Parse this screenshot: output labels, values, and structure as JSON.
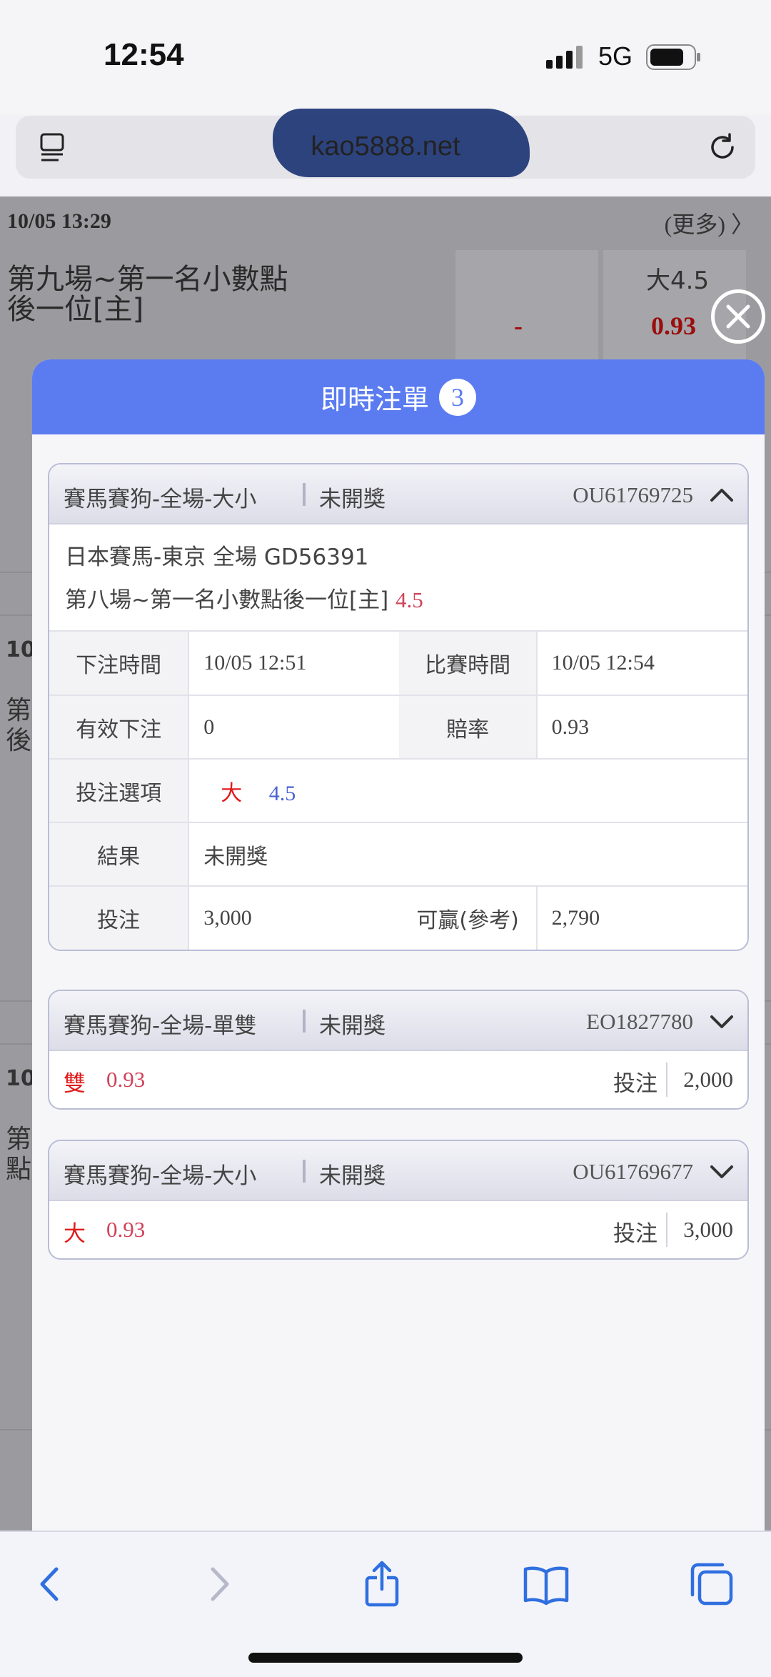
{
  "status_bar": {
    "time": "12:54",
    "network": "5G"
  },
  "browser": {
    "url": "kao5888.net"
  },
  "background": {
    "row1": {
      "datetime": "10/05  13:29",
      "more": "(更多) 〉",
      "match_line1": "第九場~第一名小數點",
      "match_line2": "後一位[主]",
      "dash": "-",
      "ou": "大4.5",
      "odds": "0.93"
    },
    "stubs": [
      "10/",
      "第",
      "後",
      "10/",
      "第",
      "點"
    ]
  },
  "modal": {
    "title": "即時注單",
    "count": "3",
    "cards": [
      {
        "type": "賽馬賽狗-全場-大小",
        "status": "未開獎",
        "code": "OU61769725",
        "league": "日本賽馬-東京 全場 GD56391",
        "match": "第八場~第一名小數點後一位[主]",
        "line": "4.5",
        "rows": {
          "bet_time_label": "下注時間",
          "bet_time": "10/05 12:51",
          "match_time_label": "比賽時間",
          "match_time": "10/05 12:54",
          "valid_label": "有效下注",
          "valid": "0",
          "odds_label": "賠率",
          "odds": "0.93",
          "option_label": "投注選項",
          "option_pick": "大",
          "option_line": "4.5",
          "result_label": "結果",
          "result": "未開獎",
          "stake_label": "投注",
          "stake": "3,000",
          "win_label": "可贏(參考)",
          "win": "2,790"
        }
      },
      {
        "type": "賽馬賽狗-全場-單雙",
        "status": "未開獎",
        "code": "EO1827780",
        "pick": "雙",
        "odds": "0.93",
        "stake_label": "投注",
        "stake": "2,000"
      },
      {
        "type": "賽馬賽狗-全場-大小",
        "status": "未開獎",
        "code": "OU61769677",
        "pick": "大",
        "odds": "0.93",
        "stake_label": "投注",
        "stake": "3,000"
      }
    ]
  },
  "colors": {
    "header_blue": "#5b7cf0",
    "odds_red": "#d0435a",
    "pick_red": "#e01b1b",
    "line_blue": "#4a62d0"
  },
  "icons": [
    "signal-icon",
    "battery-icon",
    "reader-menu-icon",
    "reload-icon",
    "close-icon",
    "chevron-up-icon",
    "chevron-down-icon",
    "back-icon",
    "forward-icon",
    "share-icon",
    "bookmarks-icon",
    "tabs-icon"
  ]
}
